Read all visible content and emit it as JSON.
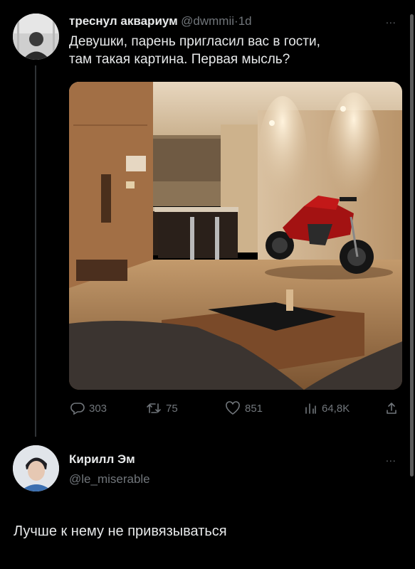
{
  "tweet": {
    "author_name": "треснул аквариум",
    "author_handle": "@dwmmii",
    "separator": "·",
    "time": "1d",
    "text_line1": "Девушки, парень пригласил вас в гости,",
    "text_line2": "там такая картина. Первая мысль?",
    "more": "...",
    "actions": {
      "replies": "303",
      "retweets": "75",
      "likes": "851",
      "views": "64,8K"
    }
  },
  "reply": {
    "author_name": "Кирилл Эм",
    "author_handle": "@le_miserable",
    "more": "...",
    "text": "Лучше к нему не привязываться"
  },
  "colors": {
    "background": "#000000",
    "text_primary": "#e7e9ea",
    "text_secondary": "#71767b",
    "thread_line": "#2f3336"
  }
}
